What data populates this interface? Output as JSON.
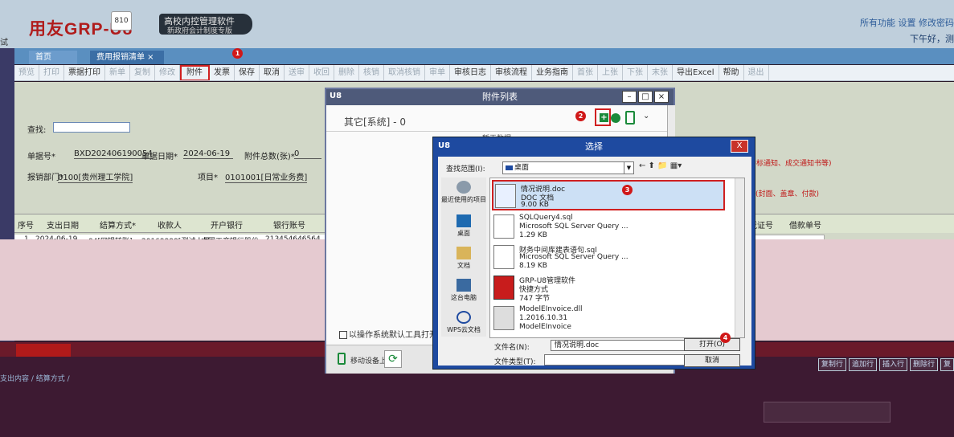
{
  "header": {
    "logo_text": "用友GRP-U8",
    "logo_badge": "810",
    "product_line1": "高校内控管理软件",
    "product_line2": "新政府会计制度专版",
    "top_links": "所有功能 设置 修改密码",
    "greeting": "下午好，测"
  },
  "side_strip": "试",
  "tabs": [
    {
      "label": "首页"
    },
    {
      "label": "费用报销清单 ×"
    }
  ],
  "badges": {
    "b1": "1",
    "b2": "2",
    "b3": "3",
    "b4": "4"
  },
  "toolbar": {
    "items": [
      {
        "label": "预览",
        "dim": true
      },
      {
        "label": "打印",
        "dim": true
      },
      {
        "label": "票据打印",
        "dim": false
      },
      {
        "label": "新单",
        "dim": true
      },
      {
        "label": "复制",
        "dim": true
      },
      {
        "label": "修改",
        "dim": true
      },
      {
        "label": "附件",
        "dim": false,
        "hl": true
      },
      {
        "label": "发票",
        "dim": false
      },
      {
        "label": "保存",
        "dim": false
      },
      {
        "label": "取消",
        "dim": false
      },
      {
        "label": "送审",
        "dim": true
      },
      {
        "label": "收回",
        "dim": true
      },
      {
        "label": "删除",
        "dim": true
      },
      {
        "label": "核销",
        "dim": true
      },
      {
        "label": "取消核销",
        "dim": true
      },
      {
        "label": "审单",
        "dim": true
      },
      {
        "label": "审核日志",
        "dim": false
      },
      {
        "label": "审核流程",
        "dim": false
      },
      {
        "label": "业务指南",
        "dim": false
      },
      {
        "label": "首张",
        "dim": true
      },
      {
        "label": "上张",
        "dim": true
      },
      {
        "label": "下张",
        "dim": true
      },
      {
        "label": "末张",
        "dim": true
      },
      {
        "label": "导出Excel",
        "dim": false
      },
      {
        "label": "帮助",
        "dim": false
      },
      {
        "label": "退出",
        "dim": true
      }
    ]
  },
  "form": {
    "search_label": "查找:",
    "doc_no_label": "单据号*",
    "doc_no": "BXD202406190054",
    "doc_date_label": "单据日期*",
    "doc_date": "2024-06-19",
    "attach_count_label": "附件总数(张)*",
    "attach_count": "0",
    "dept_label": "报销部门*",
    "dept": "0100[贵州理工学院]",
    "project_label": "项目*",
    "project": "0101001[日常业务费]",
    "notice_red": "中标通知、成交通知书等)",
    "notice_red2": "(封面、盖章、付款)"
  },
  "grid": {
    "headers": [
      "序号",
      "支出日期",
      "结算方式*",
      "收款人",
      "开户银行",
      "银行账号"
    ],
    "row": [
      "1",
      "2024-06-19",
      "04[网银转账]",
      "20169999[测试人员",
      "中国工商银行股份",
      "213454646564"
    ],
    "right_headers": [
      "凭证号",
      "借款单号"
    ]
  },
  "attachment_dialog": {
    "logo": "U8",
    "title": "附件列表",
    "category": "其它[系统] - 0",
    "sub_text": "暂无数据",
    "checkbox_label": "以操作系统默认工具打开",
    "upload_label": "移动设备上传",
    "refresh_icon": "⟳"
  },
  "chooser": {
    "logo": "U8",
    "title": "选择",
    "close": "X",
    "lookin_label": "查找范围(I):",
    "lookin_value": "桌面",
    "places": [
      "最近使用的项目",
      "桌面",
      "文档",
      "这台电脑",
      "WPS云文档"
    ],
    "files": [
      {
        "name": "情况说明.doc",
        "type": "DOC 文档",
        "size": "9.00 KB"
      },
      {
        "name": "SQLQuery4.sql",
        "type": "Microsoft SQL Server Query ...",
        "size": "1.29 KB"
      },
      {
        "name": "财务中间库建表语句.sql",
        "type": "Microsoft SQL Server Query ...",
        "size": "8.19 KB"
      },
      {
        "name": "GRP-U8管理软件",
        "type": "快捷方式",
        "size": "747 字节"
      },
      {
        "name": "ModelEInvoice.dll",
        "type": "1.2016.10.31",
        "size": "ModelEInvoice"
      }
    ],
    "filename_label": "文件名(N):",
    "filename_value": "情况说明.doc",
    "filetype_label": "文件类型(T):",
    "open_label": "打开(O)",
    "cancel_label": "取消"
  },
  "bottom_buttons": [
    "复制行",
    "追加行",
    "插入行",
    "删除行",
    "复"
  ],
  "sheet_tabs": "支出内容 / 结算方式 /",
  "colors": {
    "brand_red": "#b01c1c",
    "dialog_blue": "#1e4aa0",
    "accent_green": "#1a8a3a",
    "highlight_red": "#d02020"
  }
}
